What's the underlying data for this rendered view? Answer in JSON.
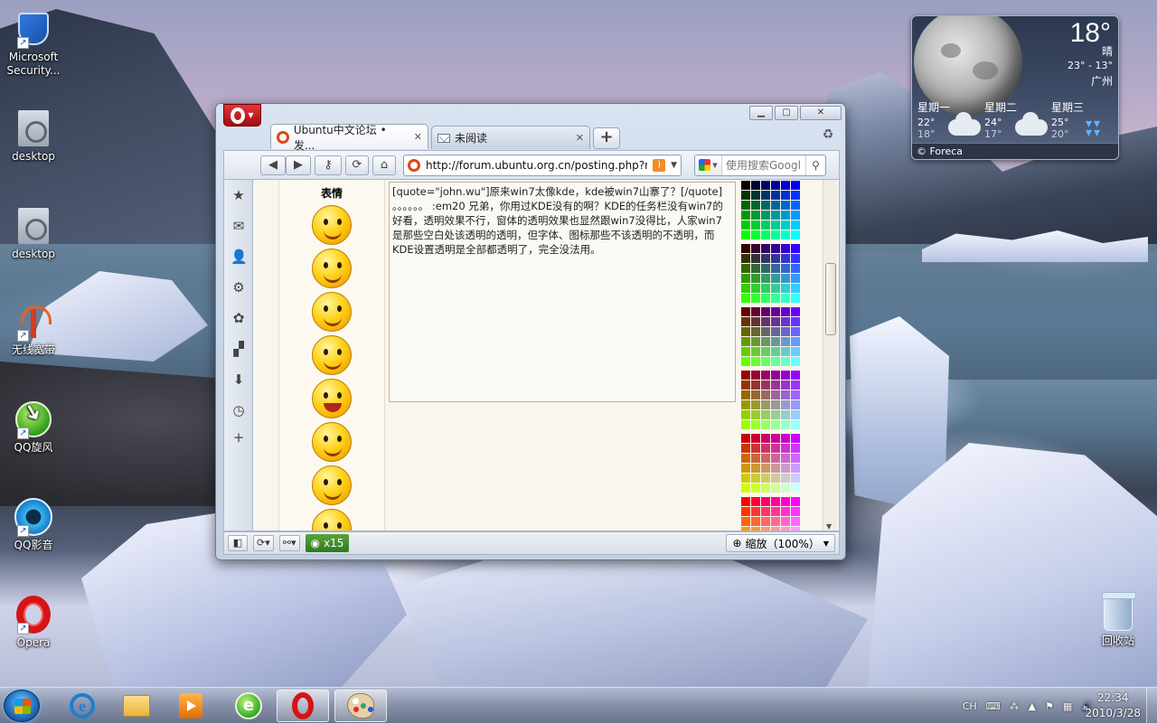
{
  "desktop": {
    "icons": [
      {
        "label": "Microsoft Security...",
        "icon": "shield-icon"
      },
      {
        "label": "desktop",
        "icon": "document-icon"
      },
      {
        "label": "desktop",
        "icon": "document-icon"
      },
      {
        "label": "无线宽带",
        "icon": "antenna-icon"
      },
      {
        "label": "QQ旋风",
        "icon": "qqxf-icon"
      },
      {
        "label": "QQ影音",
        "icon": "qqyy-icon"
      },
      {
        "label": "Opera",
        "icon": "opera-icon"
      },
      {
        "label": "回收站",
        "icon": "recycle-bin-icon"
      }
    ]
  },
  "weather": {
    "temp": "18°",
    "condition": "晴",
    "range": "23° - 13°",
    "city": "广州",
    "forecast": [
      {
        "day": "星期一",
        "hi": "22°",
        "lo": "18°",
        "icon": "cloud-icon"
      },
      {
        "day": "星期二",
        "hi": "24°",
        "lo": "17°",
        "icon": "cloud-icon"
      },
      {
        "day": "星期三",
        "hi": "25°",
        "lo": "20°",
        "icon": "rain-icon"
      }
    ],
    "credit": "© Foreca"
  },
  "browser": {
    "tabs": [
      {
        "title": "Ubuntu中文论坛 • 发...",
        "active": true
      },
      {
        "title": "未阅读",
        "active": false
      }
    ],
    "address": "http://forum.ubuntu.org.cn/posting.php?mo",
    "search_placeholder": "使用搜索Googl",
    "emoticon_panel_title": "表情",
    "post_text": "[quote=\"john.wu\"]原来win7太像kde，kde被win7山寨了？[/quote]\n。。。。。。 :em20 兄弟，你用过KDE没有的啊？KDE的任务栏没有win7的好看，透明效果不行，窗体的透明效果也显然跟win7没得比，人家win7是那些空白处该透明的透明，但字体、图标那些不该透明的不透明，而KDE设置透明是全部都透明了，完全没法用。",
    "status": {
      "counter": "x15",
      "zoom": "缩放（100%）"
    }
  },
  "taskbar": {
    "clock_time": "22:34",
    "clock_date": "2010/3/28",
    "lang": "CH"
  }
}
